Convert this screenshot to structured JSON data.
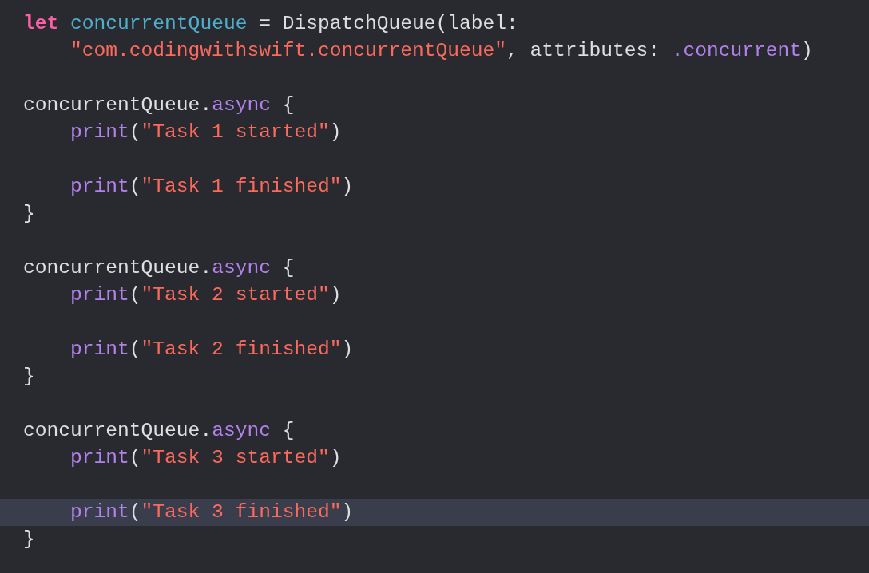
{
  "editor": {
    "lines": [
      {
        "current": false,
        "indented": false,
        "tokens": [
          {
            "kind": "keyword",
            "text": "let"
          },
          {
            "kind": "declaration",
            "text": "concurrentQueue"
          },
          {
            "kind": "plain",
            "text": " = DispatchQueue(label:"
          }
        ]
      },
      {
        "current": false,
        "indented": true,
        "tokens": [
          {
            "kind": "string",
            "text": "\"com.codingwithswift.concurrentQueue\""
          },
          {
            "kind": "plain",
            "text": ", attributes: "
          },
          {
            "kind": "member",
            "text": ".concurrent"
          },
          {
            "kind": "plain",
            "text": ")"
          }
        ]
      },
      {
        "current": false
      },
      {
        "current": false,
        "indented": false,
        "tokens": [
          {
            "kind": "plain",
            "text": "concurrentQueue."
          },
          {
            "kind": "member",
            "text": "async"
          },
          {
            "kind": "plain",
            "text": " {"
          }
        ]
      },
      {
        "current": false,
        "indented": true,
        "tokens": [
          {
            "kind": "member",
            "text": "print"
          },
          {
            "kind": "plain",
            "text": "("
          },
          {
            "kind": "string",
            "text": "\"Task 1 started\""
          },
          {
            "kind": "plain",
            "text": ")"
          }
        ]
      },
      {
        "current": false
      },
      {
        "current": false,
        "indented": true,
        "tokens": [
          {
            "kind": "member",
            "text": "print"
          },
          {
            "kind": "plain",
            "text": "("
          },
          {
            "kind": "string",
            "text": "\"Task 1 finished\""
          },
          {
            "kind": "plain",
            "text": ")"
          }
        ]
      },
      {
        "current": false,
        "indented": false,
        "tokens": [
          {
            "kind": "plain",
            "text": "}"
          }
        ]
      },
      {
        "current": false
      },
      {
        "current": false,
        "indented": false,
        "tokens": [
          {
            "kind": "plain",
            "text": "concurrentQueue."
          },
          {
            "kind": "member",
            "text": "async"
          },
          {
            "kind": "plain",
            "text": " {"
          }
        ]
      },
      {
        "current": false,
        "indented": true,
        "tokens": [
          {
            "kind": "member",
            "text": "print"
          },
          {
            "kind": "plain",
            "text": "("
          },
          {
            "kind": "string",
            "text": "\"Task 2 started\""
          },
          {
            "kind": "plain",
            "text": ")"
          }
        ]
      },
      {
        "current": false
      },
      {
        "current": false,
        "indented": true,
        "tokens": [
          {
            "kind": "member",
            "text": "print"
          },
          {
            "kind": "plain",
            "text": "("
          },
          {
            "kind": "string",
            "text": "\"Task 2 finished\""
          },
          {
            "kind": "plain",
            "text": ")"
          }
        ]
      },
      {
        "current": false,
        "indented": false,
        "tokens": [
          {
            "kind": "plain",
            "text": "}"
          }
        ]
      },
      {
        "current": false
      },
      {
        "current": false,
        "indented": false,
        "tokens": [
          {
            "kind": "plain",
            "text": "concurrentQueue."
          },
          {
            "kind": "member",
            "text": "async"
          },
          {
            "kind": "plain",
            "text": " {"
          }
        ]
      },
      {
        "current": false,
        "indented": true,
        "tokens": [
          {
            "kind": "member",
            "text": "print"
          },
          {
            "kind": "plain",
            "text": "("
          },
          {
            "kind": "string",
            "text": "\"Task 3 started\""
          },
          {
            "kind": "plain",
            "text": ")"
          }
        ]
      },
      {
        "current": false
      },
      {
        "current": true,
        "indented": true,
        "tokens": [
          {
            "kind": "member",
            "text": "print"
          },
          {
            "kind": "plain",
            "text": "("
          },
          {
            "kind": "string",
            "text": "\"Task 3 finished\""
          },
          {
            "kind": "plain",
            "text": ")"
          }
        ]
      },
      {
        "current": false,
        "indented": false,
        "tokens": [
          {
            "kind": "plain",
            "text": "}"
          }
        ]
      }
    ]
  }
}
